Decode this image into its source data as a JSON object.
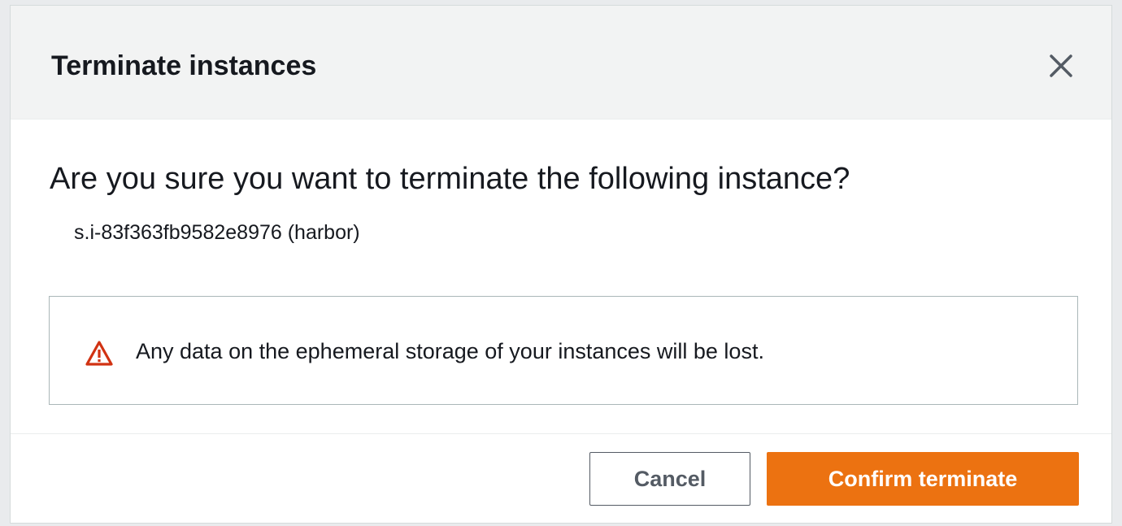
{
  "dialog": {
    "title": "Terminate instances",
    "close_icon": "close-icon"
  },
  "body": {
    "question": "Are you sure you want to terminate the following instance?",
    "instance": "s.i-83f363fb9582e8976 (harbor)",
    "alert": {
      "icon": "warning-icon",
      "message": "Any data on the ephemeral storage of your instances will be lost."
    }
  },
  "footer": {
    "cancel_label": "Cancel",
    "confirm_label": "Confirm terminate"
  },
  "colors": {
    "primary_button": "#ec7211",
    "warning": "#d13212",
    "header_background": "#f2f3f3"
  }
}
